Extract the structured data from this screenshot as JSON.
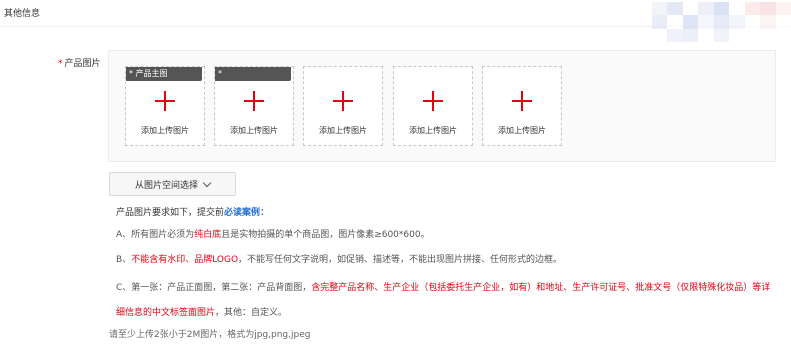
{
  "section_title": "其他信息",
  "field": {
    "required_mark": "*",
    "label": "产品图片"
  },
  "slots": [
    {
      "tag": "* 产品主图",
      "caption": "添加上传图片"
    },
    {
      "tag": "*",
      "caption": "添加上传图片"
    },
    {
      "tag": "",
      "caption": "添加上传图片"
    },
    {
      "tag": "",
      "caption": "添加上传图片"
    },
    {
      "tag": "",
      "caption": "添加上传图片"
    }
  ],
  "space_button_label": "从图片空间选择",
  "requirements": {
    "intro_prefix": "产品图片要求如下，提交前",
    "intro_link": "必读案例",
    "intro_suffix": "：",
    "rule_a": {
      "p1": "A、所有图片必须为",
      "red1": "纯白底",
      "p2": "且是实物拍摄的单个商品图，图片像素≥600*600。"
    },
    "rule_b": {
      "p1": "B、",
      "red1": "不能含有水印、品牌LOGO",
      "p2": "，不能写任何文字说明，如促销、描述等，不能出现图片拼接、任何形式的边框。"
    },
    "rule_c": {
      "p1": "C、第一张：产品正面图，第二张：产品背面图，",
      "red1": "含完整产品名称、生产企业（包括委托生产企业，如有）和地址、生产许可证号、批准文号（仅限特殊化妆品）等详细信息的中文标签面图片",
      "p2": "，其他：自定义。"
    }
  },
  "footer_note": "请至少上传2张小于2M图片，格式为jpg,png,jpeg",
  "colors": {
    "accent_red": "#e60012",
    "link_blue": "#1f6fd1",
    "tag_bg": "#555555"
  },
  "icons": {
    "plus": "plus-icon",
    "chevron": "chevron-down-icon"
  }
}
